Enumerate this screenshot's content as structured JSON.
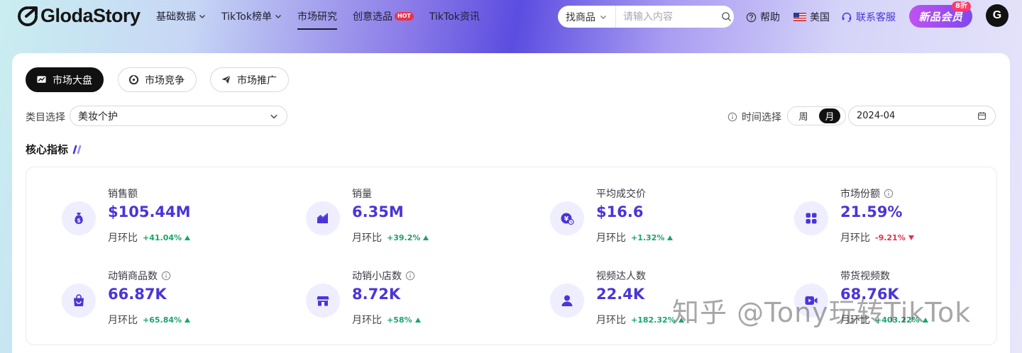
{
  "brand": {
    "name": "GlodaStory"
  },
  "nav": {
    "items": [
      {
        "label": "基础数据",
        "dropdown": true
      },
      {
        "label": "TikTok榜单",
        "dropdown": true
      },
      {
        "label": "市场研究",
        "active": true
      },
      {
        "label": "创意选品",
        "badge": "HOT"
      },
      {
        "label": "TikTok资讯"
      }
    ]
  },
  "search": {
    "type_label": "找商品",
    "placeholder": "请输入内容"
  },
  "utils": {
    "help": "帮助",
    "country": "美国",
    "service": "联系客服"
  },
  "vip": {
    "label": "新品会员",
    "badge": "8折"
  },
  "user": {
    "avatar_letter": "G"
  },
  "tabs": [
    {
      "label": "市场大盘",
      "active": true,
      "icon": "market-overview-icon"
    },
    {
      "label": "市场竞争",
      "icon": "competition-icon"
    },
    {
      "label": "市场推广",
      "icon": "promotion-icon"
    }
  ],
  "filters": {
    "category_label": "类目选择",
    "category_value": "美妆个护",
    "time_label": "时间选择",
    "period_options": [
      "周",
      "月"
    ],
    "period_selected": "月",
    "date_value": "2024-04"
  },
  "section": {
    "title": "核心指标"
  },
  "metrics": [
    {
      "label": "销售额",
      "value": "$105.44M",
      "change_label": "月环比",
      "change": "+41.04%",
      "direction": "up",
      "icon": "money-bag-icon",
      "info": false
    },
    {
      "label": "销量",
      "value": "6.35M",
      "change_label": "月环比",
      "change": "+39.2%",
      "direction": "up",
      "icon": "trend-area-icon",
      "info": false
    },
    {
      "label": "平均成交价",
      "value": "$16.6",
      "change_label": "月环比",
      "change": "+1.32%",
      "direction": "up",
      "icon": "price-coin-icon",
      "info": false
    },
    {
      "label": "市场份额",
      "value": "21.59%",
      "change_label": "月环比",
      "change": "-9.21%",
      "direction": "down",
      "icon": "grid-apps-icon",
      "info": true
    },
    {
      "label": "动销商品数",
      "value": "66.87K",
      "change_label": "月环比",
      "change": "+65.84%",
      "direction": "up",
      "icon": "shopping-bag-icon",
      "info": true
    },
    {
      "label": "动销小店数",
      "value": "8.72K",
      "change_label": "月环比",
      "change": "+58%",
      "direction": "up",
      "icon": "store-icon",
      "info": true
    },
    {
      "label": "视频达人数",
      "value": "22.4K",
      "change_label": "月环比",
      "change": "+182.32%",
      "direction": "up",
      "icon": "person-icon",
      "info": false
    },
    {
      "label": "带货视频数",
      "value": "68.76K",
      "change_label": "月环比",
      "change": "+403.22%",
      "direction": "up",
      "icon": "video-icon",
      "info": false
    }
  ],
  "watermark": "知乎 @Tony玩转TikTok",
  "colors": {
    "accent": "#4a35d9",
    "up": "#19a56a",
    "down": "#e0334c"
  }
}
